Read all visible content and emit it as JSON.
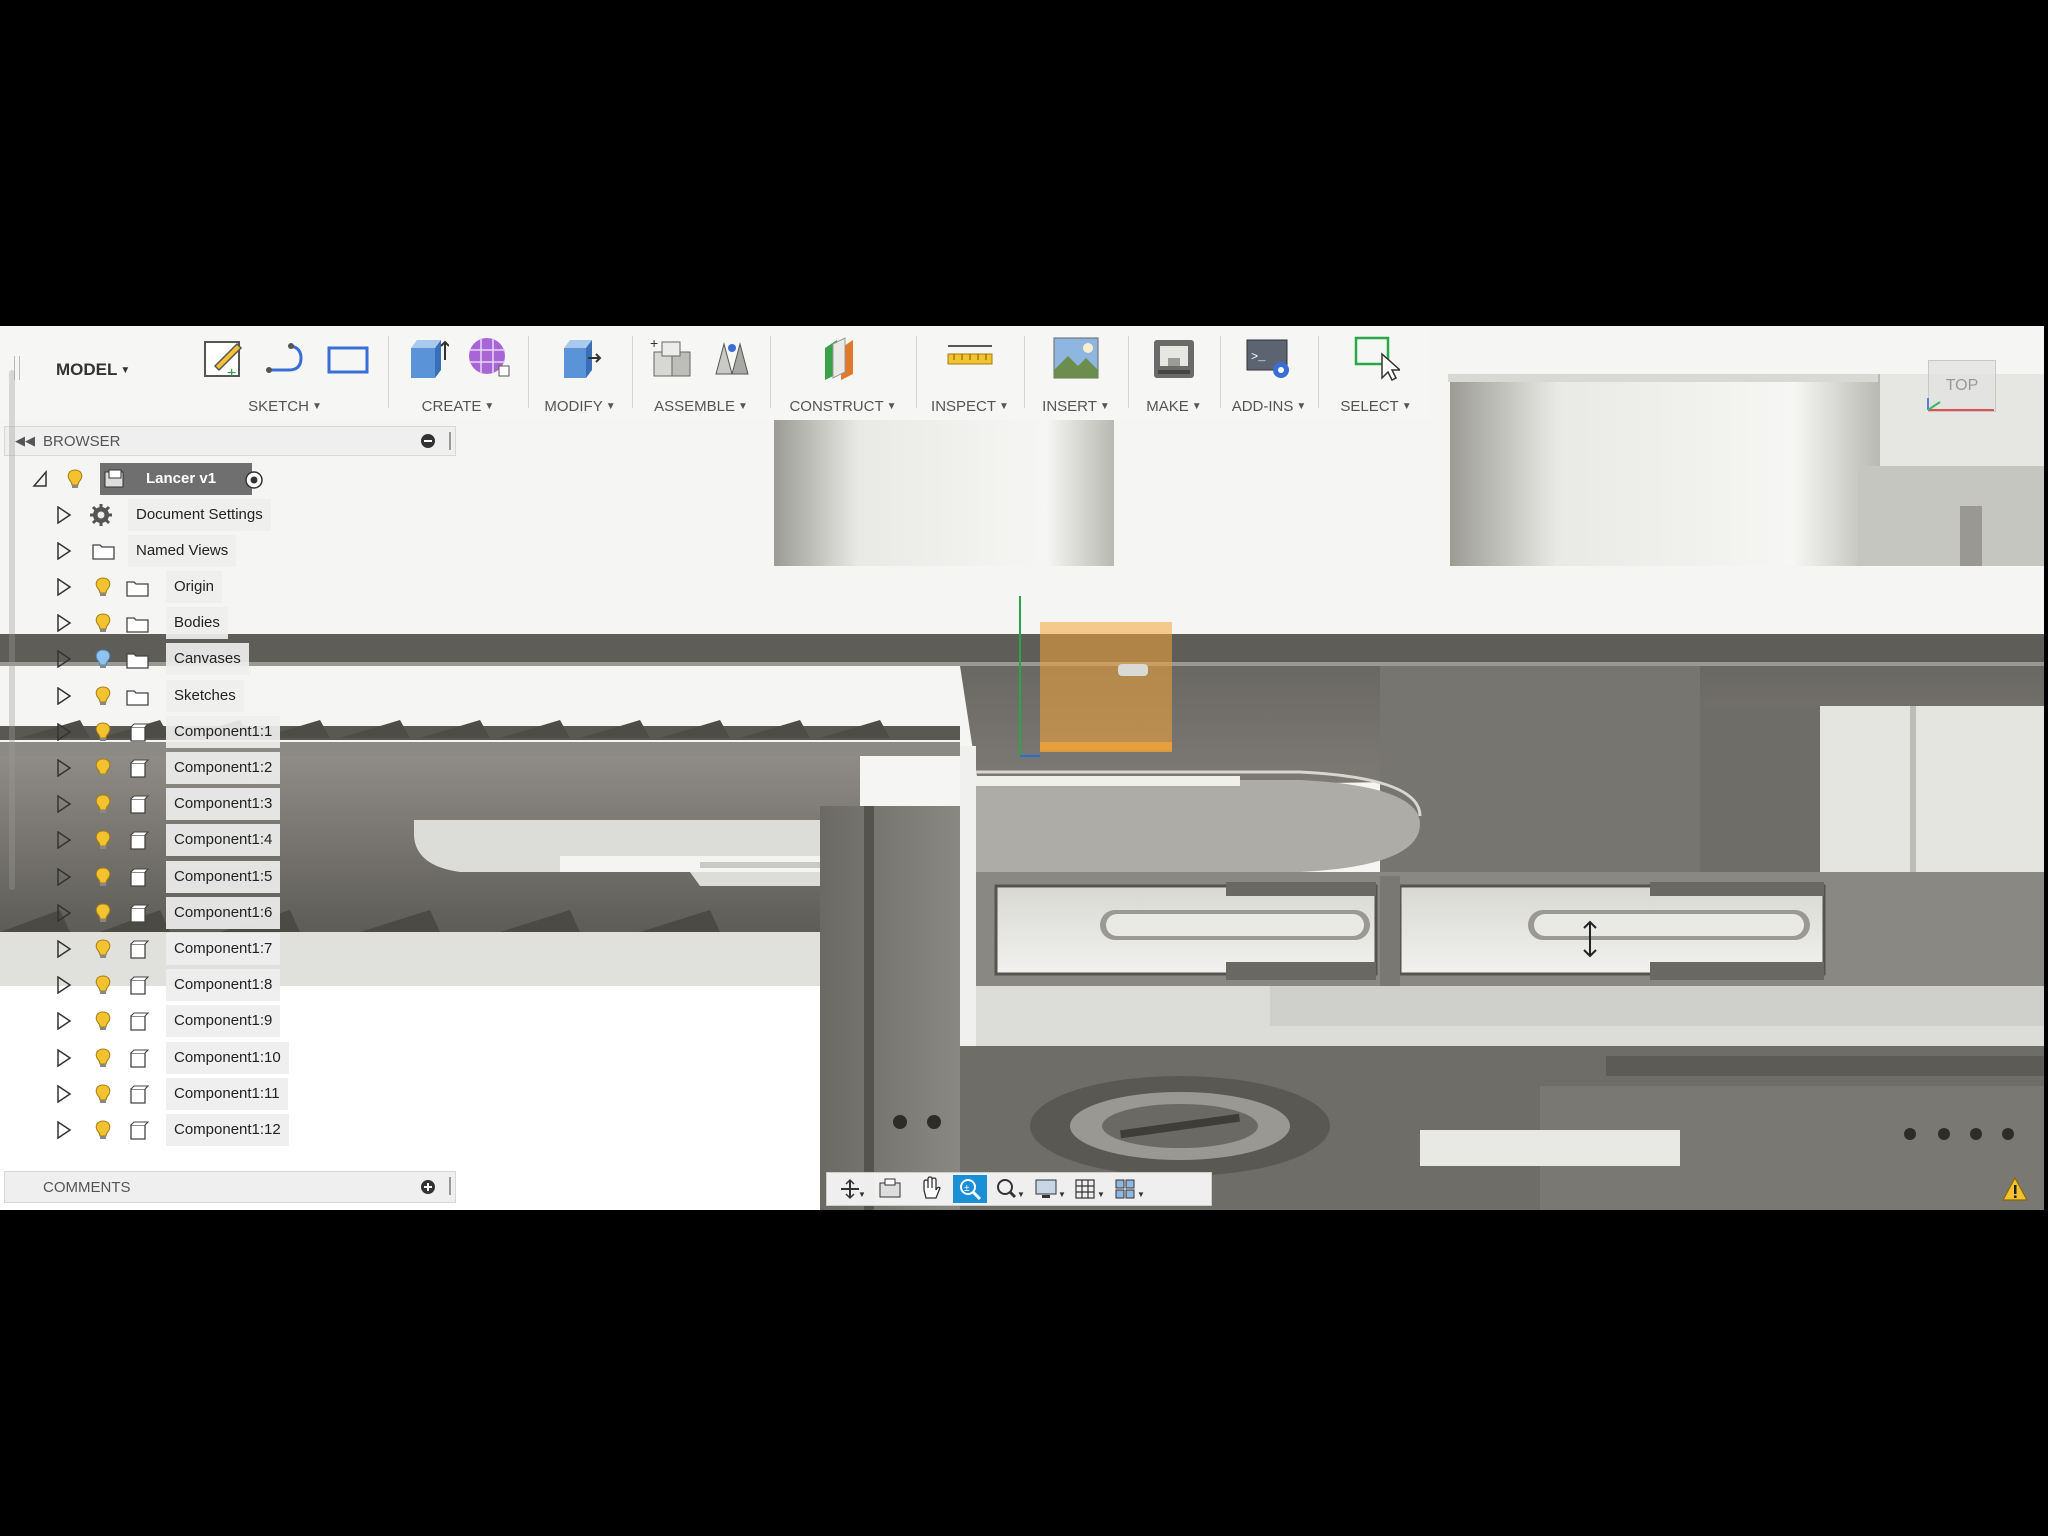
{
  "toolbar": {
    "workspace_label": "MODEL",
    "groups": {
      "sketch": "SKETCH",
      "create": "CREATE",
      "modify": "MODIFY",
      "assemble": "ASSEMBLE",
      "construct": "CONSTRUCT",
      "inspect": "INSPECT",
      "insert": "INSERT",
      "make": "MAKE",
      "addins": "ADD-INS",
      "select": "SELECT"
    }
  },
  "browser": {
    "header": "BROWSER",
    "root": {
      "label": "Lancer v1"
    },
    "items": [
      {
        "label": "Document Settings",
        "icon": "gear-icon"
      },
      {
        "label": "Named Views",
        "icon": "folder-icon"
      },
      {
        "label": "Origin",
        "icon": "folder-icon"
      },
      {
        "label": "Bodies",
        "icon": "folder-icon"
      },
      {
        "label": "Canvases",
        "icon": "folder-icon"
      },
      {
        "label": "Sketches",
        "icon": "folder-icon"
      },
      {
        "label": "Component1:1",
        "icon": "component-icon"
      },
      {
        "label": "Component1:2",
        "icon": "component-icon"
      },
      {
        "label": "Component1:3",
        "icon": "component-icon"
      },
      {
        "label": "Component1:4",
        "icon": "component-icon"
      },
      {
        "label": "Component1:5",
        "icon": "component-icon"
      },
      {
        "label": "Component1:6",
        "icon": "component-icon"
      },
      {
        "label": "Component1:7",
        "icon": "component-icon"
      },
      {
        "label": "Component1:8",
        "icon": "component-icon"
      },
      {
        "label": "Component1:9",
        "icon": "component-icon"
      },
      {
        "label": "Component1:10",
        "icon": "component-icon"
      },
      {
        "label": "Component1:11",
        "icon": "component-icon"
      },
      {
        "label": "Component1:12",
        "icon": "component-icon"
      }
    ]
  },
  "comments": {
    "label": "COMMENTS"
  },
  "viewcube": {
    "face": "TOP"
  },
  "colors": {
    "accent": "#1b8fd6",
    "bulb": "#f2c230",
    "bulb_off": "#8fc3ee",
    "selection": "#f3a43a"
  }
}
